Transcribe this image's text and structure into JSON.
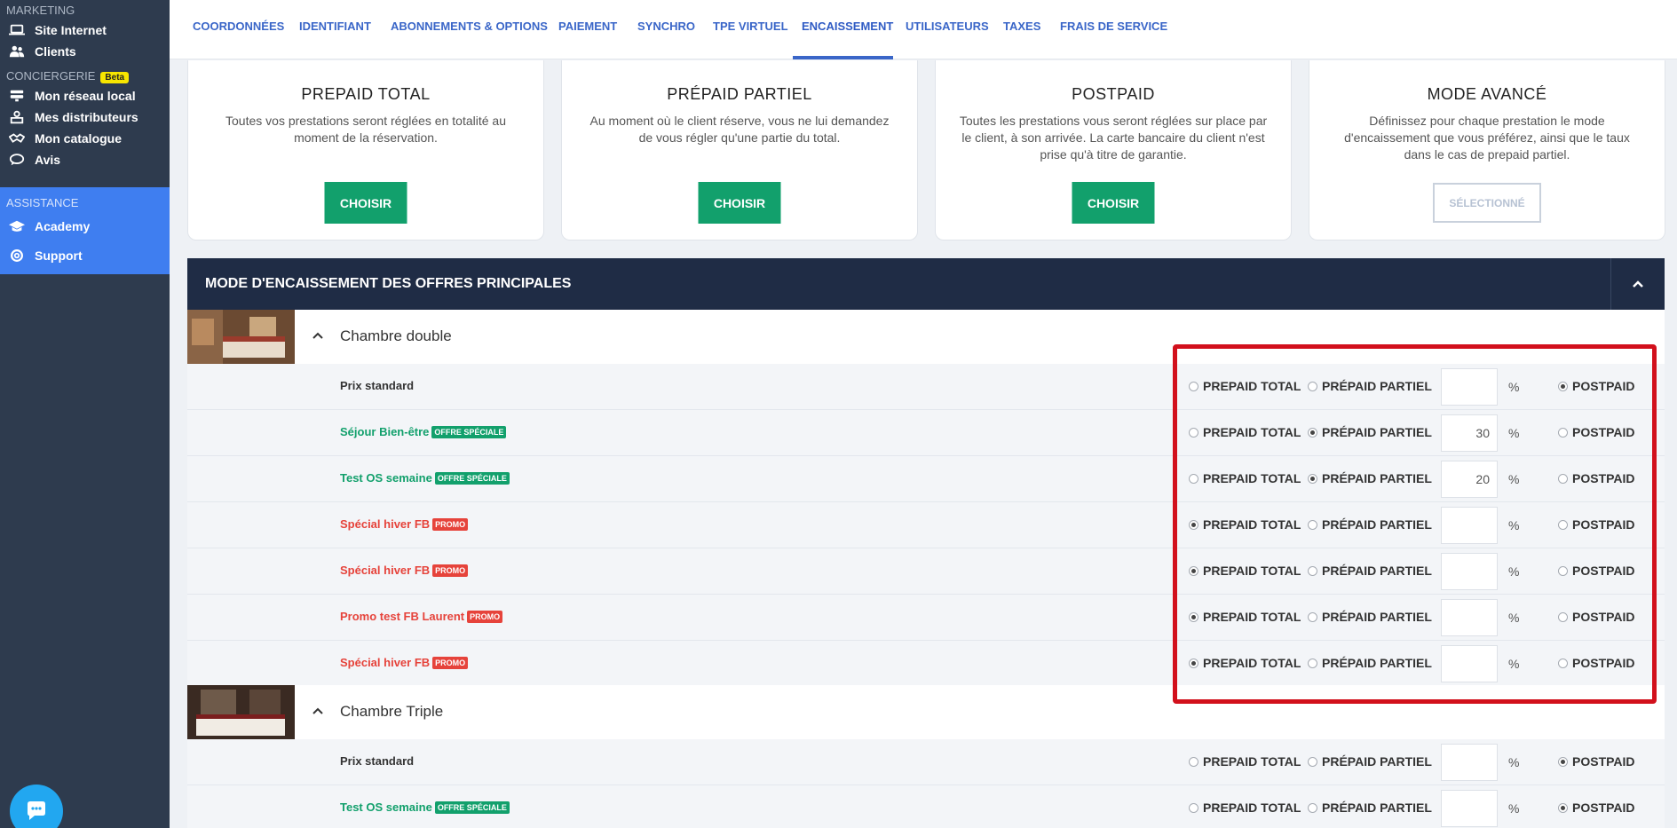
{
  "sidebar": {
    "marketing_label": "MARKETING",
    "site_internet": "Site Internet",
    "clients": "Clients",
    "conciergerie_label": "CONCIERGERIE",
    "beta_label": "Beta",
    "reseau_local": "Mon réseau local",
    "distributeurs": "Mes distributeurs",
    "catalogue": "Mon catalogue",
    "avis": "Avis",
    "assistance_label": "ASSISTANCE",
    "academy": "Academy",
    "support": "Support"
  },
  "tabs": [
    "COORDONNÉES",
    "IDENTIFIANT",
    "ABONNEMENTS & OPTIONS",
    "PAIEMENT",
    "SYNCHRO",
    "TPE VIRTUEL",
    "ENCAISSEMENT",
    "UTILISATEURS",
    "TAXES",
    "FRAIS DE SERVICE"
  ],
  "cards": [
    {
      "title": "PREPAID TOTAL",
      "desc": "Toutes vos prestations seront réglées en totalité au moment de la réservation.",
      "button": "CHOISIR"
    },
    {
      "title": "PRÉPAID PARTIEL",
      "desc": "Au moment où le client réserve, vous ne lui demandez de vous régler qu'une partie du total.",
      "button": "CHOISIR"
    },
    {
      "title": "POSTPAID",
      "desc": "Toutes les prestations vous seront réglées sur place par le client, à son arrivée. La carte bancaire du client n'est prise qu'à titre de garantie.",
      "button": "CHOISIR"
    },
    {
      "title": "MODE AVANCÉ",
      "desc": "Définissez pour chaque prestation le mode d'encaissement que vous préférez, ainsi que le taux dans le cas de prepaid partiel.",
      "button": "SÉLECTIONNÉ"
    }
  ],
  "section": {
    "title": "MODE D'ENCAISSEMENT DES OFFRES PRINCIPALES"
  },
  "options": {
    "prepaid_total": "PREPAID TOTAL",
    "prepaid_partiel": "PRÉPAID PARTIEL",
    "postpaid": "POSTPAID",
    "percent": "%"
  },
  "badges": {
    "special": "OFFRE SPÉCIALE",
    "promo": "PROMO"
  },
  "rooms": [
    {
      "name": "Chambre double",
      "rates": [
        {
          "name": "Prix standard",
          "type": "std",
          "badge": "",
          "selected": "postpaid",
          "percent": ""
        },
        {
          "name": "Séjour Bien-être",
          "type": "special",
          "badge": "OFFRE SPÉCIALE",
          "selected": "prepaid_partiel",
          "percent": "30"
        },
        {
          "name": "Test OS semaine",
          "type": "special",
          "badge": "OFFRE SPÉCIALE",
          "selected": "prepaid_partiel",
          "percent": "20"
        },
        {
          "name": "Spécial hiver FB",
          "type": "promo",
          "badge": "PROMO",
          "selected": "prepaid_total",
          "percent": ""
        },
        {
          "name": "Spécial hiver FB",
          "type": "promo",
          "badge": "PROMO",
          "selected": "prepaid_total",
          "percent": ""
        },
        {
          "name": "Promo test FB Laurent",
          "type": "promo",
          "badge": "PROMO",
          "selected": "prepaid_total",
          "percent": ""
        },
        {
          "name": "Spécial hiver FB",
          "type": "promo",
          "badge": "PROMO",
          "selected": "prepaid_total",
          "percent": ""
        }
      ]
    },
    {
      "name": "Chambre Triple",
      "rates": [
        {
          "name": "Prix standard",
          "type": "std",
          "badge": "",
          "selected": "postpaid",
          "percent": ""
        },
        {
          "name": "Test OS semaine",
          "type": "special",
          "badge": "OFFRE SPÉCIALE",
          "selected": "postpaid",
          "percent": ""
        }
      ]
    }
  ]
}
